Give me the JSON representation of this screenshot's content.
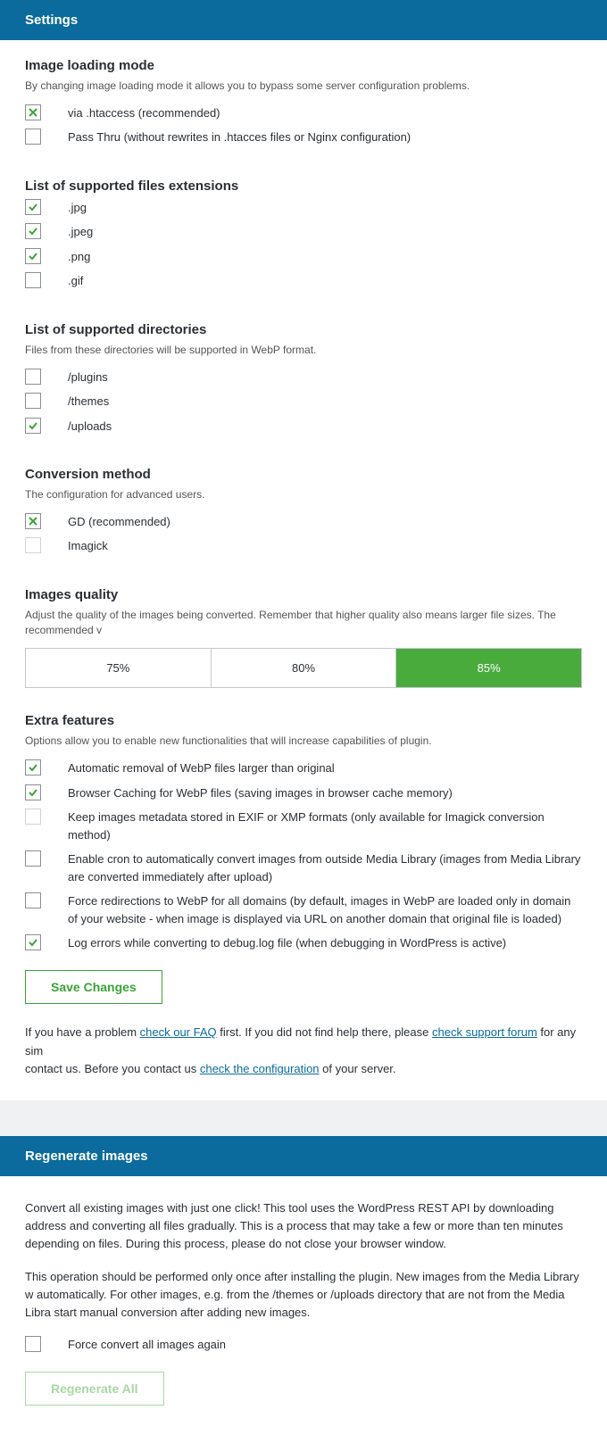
{
  "settings": {
    "header": "Settings",
    "loading_mode": {
      "title": "Image loading mode",
      "desc": "By changing image loading mode it allows you to bypass some server configuration problems.",
      "opt_htaccess": "via .htaccess (recommended)",
      "opt_passthru": "Pass Thru (without rewrites in .htacces files or Nginx configuration)"
    },
    "extensions": {
      "title": "List of supported files extensions",
      "jpg": ".jpg",
      "jpeg": ".jpeg",
      "png": ".png",
      "gif": ".gif"
    },
    "directories": {
      "title": "List of supported directories",
      "desc": "Files from these directories will be supported in WebP format.",
      "plugins": "/plugins",
      "themes": "/themes",
      "uploads": "/uploads"
    },
    "conversion": {
      "title": "Conversion method",
      "desc": "The configuration for advanced users.",
      "gd": "GD (recommended)",
      "imagick": "Imagick"
    },
    "quality": {
      "title": "Images quality",
      "desc": "Adjust the quality of the images being converted. Remember that higher quality also means larger file sizes. The recommended v",
      "q75": "75%",
      "q80": "80%",
      "q85": "85%"
    },
    "extra": {
      "title": "Extra features",
      "desc": "Options allow you to enable new functionalities that will increase capabilities of plugin.",
      "auto_remove": "Automatic removal of WebP files larger than original",
      "caching": "Browser Caching for WebP files (saving images in browser cache memory)",
      "metadata": "Keep images metadata stored in EXIF or XMP formats (only available for Imagick conversion method)",
      "cron": "Enable cron to automatically convert images from outside Media Library (images from Media Library are converted immediately after upload)",
      "redirect": "Force redirections to WebP for all domains (by default, images in WebP are loaded only in domain of your website - when image is displayed via URL on another domain that original file is loaded)",
      "log": "Log errors while converting to debug.log file (when debugging in WordPress is active)"
    },
    "save_btn": "Save Changes",
    "help": {
      "p1a": "If you have a problem ",
      "link_faq": "check our FAQ",
      "p1b": " first. If you did not find help there, please ",
      "link_forum": "check support forum",
      "p1c": " for any sim",
      "p2a": "contact us. Before you contact us ",
      "link_config": "check the configuration",
      "p2b": " of your server."
    }
  },
  "regen": {
    "header": "Regenerate images",
    "p1": "Convert all existing images with just one click! This tool uses the WordPress REST API by downloading address and converting all files gradually. This is a process that may take a few or more than ten minutes depending on files. During this process, please do not close your browser window.",
    "p2": "This operation should be performed only once after installing the plugin. New images from the Media Library w automatically. For other images, e.g. from the /themes or /uploads directory that are not from the Media Libra start manual conversion after adding new images.",
    "force": "Force convert all images again",
    "btn": "Regenerate All"
  }
}
